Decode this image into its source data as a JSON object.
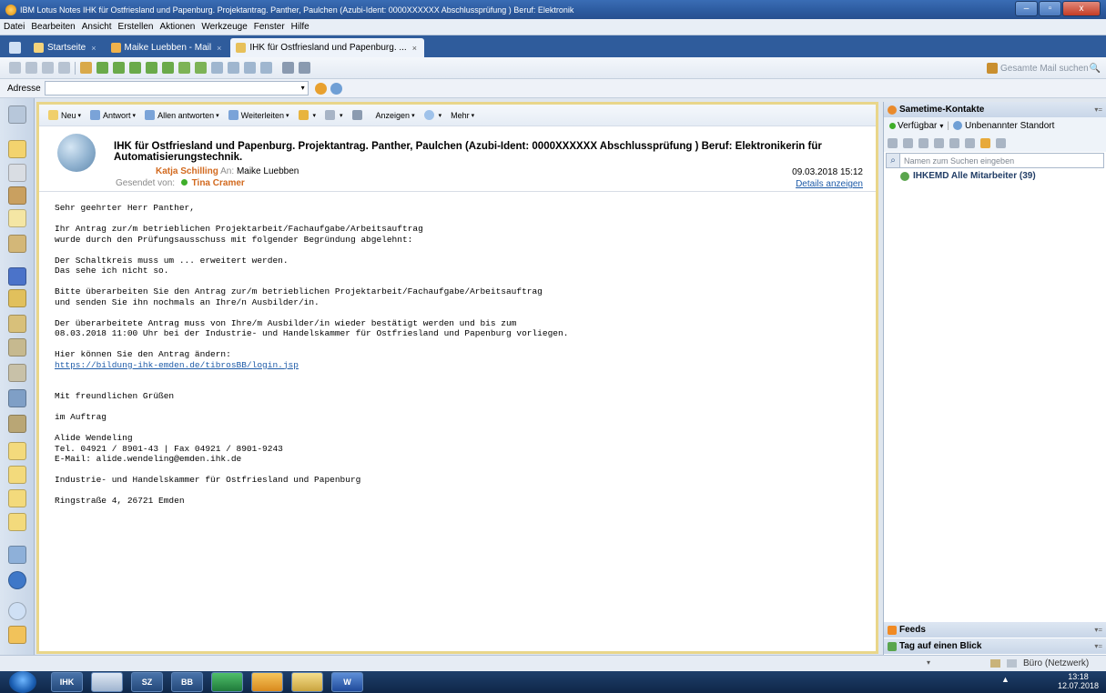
{
  "window": {
    "title": "IBM Lotus Notes IHK für Ostfriesland und Papenburg. Projektantrag. Panther, Paulchen (Azubi-Ident: 0000XXXXXX Abschlussprüfung ) Beruf: Elektronik",
    "minimize": "–",
    "maximize": "▫",
    "close": "x"
  },
  "menu": [
    "Datei",
    "Bearbeiten",
    "Ansicht",
    "Erstellen",
    "Aktionen",
    "Werkzeuge",
    "Fenster",
    "Hilfe"
  ],
  "tabs": [
    {
      "label": "Startseite",
      "close": "×"
    },
    {
      "label": "Maike Luebben - Mail",
      "close": "×"
    },
    {
      "label": "IHK für Ostfriesland und Papenburg. ...",
      "close": "×"
    }
  ],
  "toolbar": {
    "search_placeholder": "Gesamte Mail suchen",
    "search_icon": "🔍"
  },
  "address": {
    "label": "Adresse",
    "value": "",
    "dropdown": "▾"
  },
  "actions": [
    {
      "label": "Neu",
      "dropdown": "▾"
    },
    {
      "label": "Antwort",
      "dropdown": "▾"
    },
    {
      "label": "Allen antworten",
      "dropdown": "▾"
    },
    {
      "label": "Weiterleiten",
      "dropdown": "▾"
    },
    {
      "label": "",
      "dropdown": "▾"
    },
    {
      "label": "",
      "dropdown": "▾"
    },
    {
      "label": "",
      "dropdown": ""
    },
    {
      "label": "Anzeigen",
      "dropdown": "▾"
    },
    {
      "label": "",
      "dropdown": "▾"
    },
    {
      "label": "Mehr",
      "dropdown": "▾"
    }
  ],
  "mail": {
    "subject": "IHK für Ostfriesland und Papenburg. Projektantrag. Panther, Paulchen (Azubi-Ident: 0000XXXXXX Abschlussprüfung ) Beruf: Elektronikerin für Automatisierungstechnik.",
    "from": "Katja Schilling",
    "to_label": "An:",
    "to": "Maike Luebben",
    "sent_by_label": "Gesendet von:",
    "sent_by": "Tina Cramer",
    "date": "09.03.2018 15:12",
    "details": "Details anzeigen",
    "body": [
      "Sehr geehrter Herr Panther,",
      "",
      "Ihr Antrag zur/m betrieblichen Projektarbeit/Fachaufgabe/Arbeitsauftrag",
      "wurde durch den Prüfungsausschuss mit folgender Begründung abgelehnt:",
      "",
      "Der Schaltkreis muss um ... erweitert werden.",
      "Das sehe ich nicht so.",
      "",
      "Bitte überarbeiten Sie den Antrag zur/m betrieblichen Projektarbeit/Fachaufgabe/Arbeitsauftrag",
      "und senden Sie ihn nochmals an Ihre/n Ausbilder/in.",
      "",
      "Der überarbeitete Antrag muss von Ihre/m Ausbilder/in wieder bestätigt werden und bis zum",
      "08.03.2018 11:00 Uhr bei der Industrie- und Handelskammer für Ostfriesland und Papenburg vorliegen.",
      "",
      "Hier können Sie den Antrag ändern:"
    ],
    "link": "https://bildung-ihk-emden.de/tibrosBB/login.jsp",
    "closing": [
      "",
      "",
      "Mit freundlichen Grüßen",
      "",
      "im Auftrag",
      "",
      "Alide Wendeling",
      "Tel. 04921 / 8901-43 | Fax 04921 / 8901-9243",
      "E-Mail: alide.wendeling@emden.ihk.de",
      "",
      "Industrie- und Handelskammer für Ostfriesland und Papenburg",
      "",
      "Ringstraße 4, 26721 Emden"
    ]
  },
  "sidebar": {
    "title": "Sametime-Kontakte",
    "status": "Verfügbar",
    "status_dropdown": "▾",
    "location": "Unbenannter Standort",
    "search_placeholder": "Namen zum Suchen eingeben",
    "group": "IHKEMD Alle Mitarbeiter (39)",
    "feeds": "Feeds",
    "glance": "Tag auf einen Blick",
    "menu": "▾="
  },
  "statusbar": {
    "network": "Büro (Netzwerk)",
    "dropdown": "▾"
  },
  "taskbar": {
    "apps": [
      "IHK",
      "",
      "SZ",
      "BB",
      "",
      "",
      "",
      "W"
    ],
    "clock_time": "13:18",
    "clock_date": "12.07.2018",
    "tray": "▲"
  },
  "colors": {
    "accent": "#2f5c9c",
    "sender": "#d2691e",
    "link": "#1e5ba8",
    "frame": "#e9d68a"
  }
}
